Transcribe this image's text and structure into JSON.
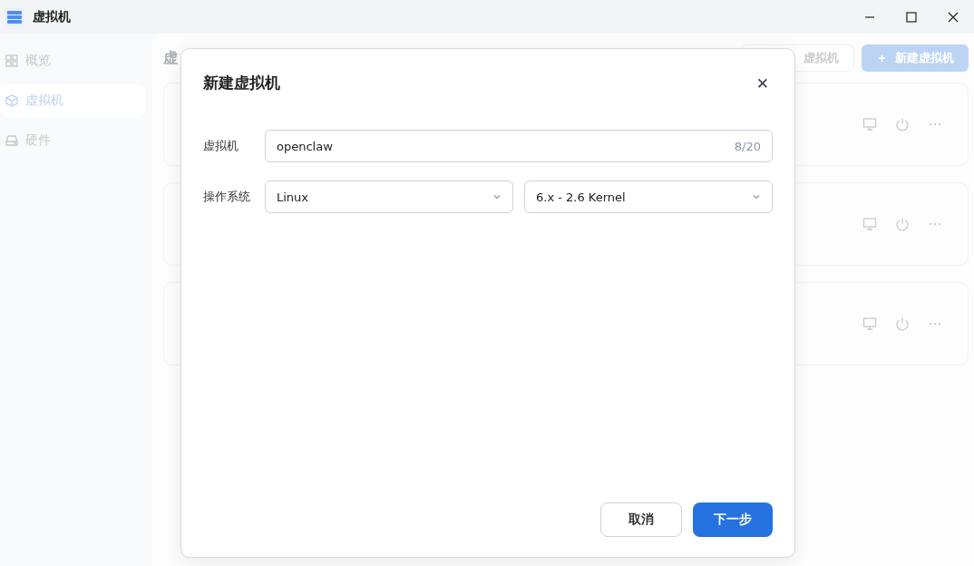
{
  "window": {
    "title": "虚拟机"
  },
  "sidebar": {
    "items": [
      {
        "label": "概览",
        "selected": false
      },
      {
        "label": "虚拟机",
        "selected": true
      },
      {
        "label": "硬件",
        "selected": false
      }
    ]
  },
  "page": {
    "heading": "虚",
    "toolbar_buttons": [
      {
        "label": "虚拟机",
        "kind": "outline"
      },
      {
        "label": "新建虚拟机",
        "icon": "＋",
        "kind": "primary"
      }
    ]
  },
  "dialog": {
    "title": "新建虚拟机",
    "close": "✕",
    "name_field": {
      "label": "虚拟机",
      "value": "openclaw",
      "counter": "8/20"
    },
    "os_field": {
      "label": "操作系统",
      "selects": [
        {
          "value": "Linux"
        },
        {
          "value": "6.x - 2.6 Kernel"
        }
      ]
    },
    "buttons": [
      {
        "label": "取消",
        "kind": "secondary"
      },
      {
        "label": "下一步",
        "kind": "primary"
      }
    ]
  }
}
